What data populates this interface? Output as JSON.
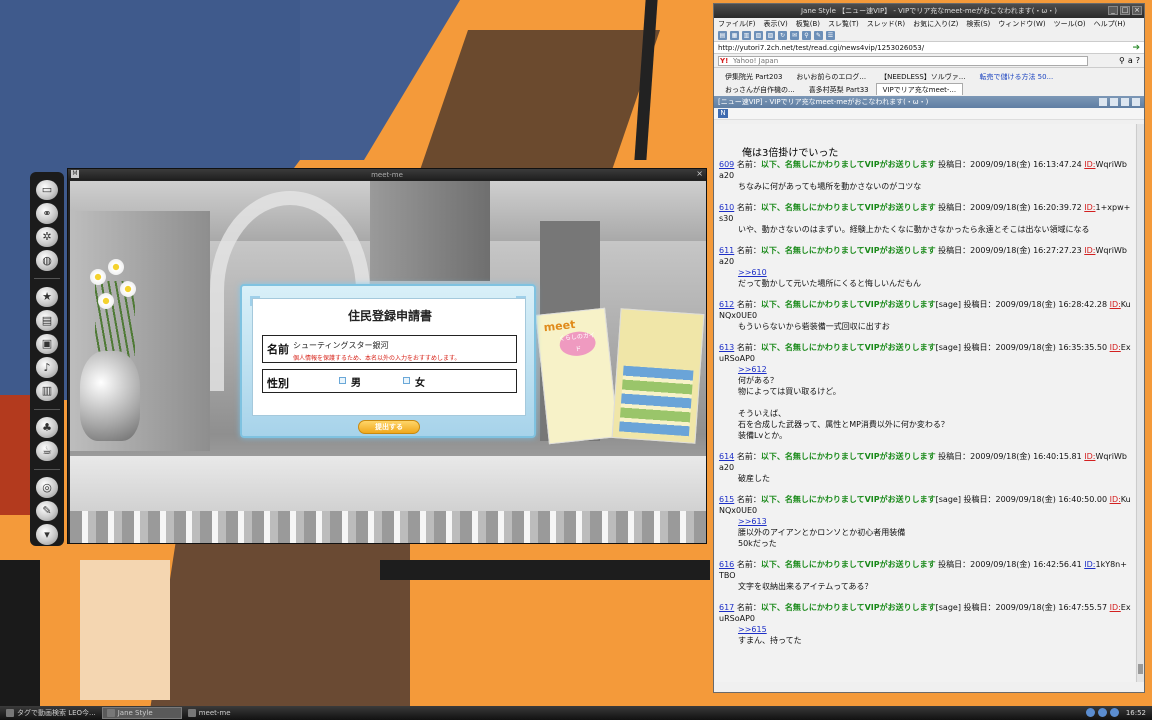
{
  "meetme": {
    "title": "meet-me",
    "brochure_logo": "meet",
    "brochure_guide": "くらしのガイド",
    "dialog": {
      "title": "住民登録申請書",
      "name_label": "名前",
      "name_value": "シューティングスター銀河",
      "name_note": "個人情報を保護するため、本名以外の入力をおすすめします。",
      "gender_label": "性別",
      "male": "男",
      "female": "女",
      "submit": "提出する"
    }
  },
  "jane": {
    "title": "Jane Style 【ニュー速VIP】 - VIPでリア充なmeet-meがおこなわれます(・ω・)",
    "menu": [
      "ファイル(F)",
      "表示(V)",
      "板覧(B)",
      "スレ覧(T)",
      "スレッド(R)",
      "お気に入り(Z)",
      "検索(S)",
      "ウィンドウ(W)",
      "ツール(O)",
      "ヘルプ(H)"
    ],
    "url": "http://yutori7.2ch.net/test/read.cgi/news4vip/1253026053/",
    "search_placeholder": "Yahoo! Japan",
    "tabs": [
      {
        "label": "伊集院光 Part203",
        "blue": false,
        "active": false
      },
      {
        "label": "おいお前らのエログ...",
        "blue": false,
        "active": false
      },
      {
        "label": "【NEEDLESS】ソルヴァ...",
        "blue": false,
        "active": false
      },
      {
        "label": "転売で儲ける方法 50...",
        "blue": true,
        "active": false
      },
      {
        "label": "おっさんが自作機の...",
        "blue": false,
        "active": false
      },
      {
        "label": "喜多村英梨 Part33",
        "blue": false,
        "active": false
      },
      {
        "label": "VIPでリア充なmeet-...",
        "blue": false,
        "active": true
      }
    ],
    "thread_title": "[ニュー速VIP] - VIPでリア充なmeet-meがおこなわれます(・ω・)",
    "first_line": "俺は3倍掛けでいった",
    "posts": [
      {
        "num": "609",
        "name_prefix": "名前：",
        "name": "以下、名無しにかわりましてVIPがお送りします",
        "mail": "",
        "date": "投稿日：2009/09/18(金) 16:13:47.24",
        "id_label": "ID:",
        "id": "WqriWba20",
        "id_red": true,
        "anchor": "",
        "lines": [
          "ちなみに何があっても場所を動かさないのがコツな"
        ]
      },
      {
        "num": "610",
        "name_prefix": "名前：",
        "name": "以下、名無しにかわりましてVIPがお送りします",
        "mail": "",
        "date": "投稿日：2009/09/18(金) 16:20:39.72",
        "id_label": "ID:",
        "id": "1+xpw+s30",
        "id_red": true,
        "anchor": "",
        "lines": [
          "いや、動かさないのはまずい。経験上かたくなに動かさなかったら永遠とそこは出ない領域になる"
        ]
      },
      {
        "num": "611",
        "name_prefix": "名前：",
        "name": "以下、名無しにかわりましてVIPがお送りします",
        "mail": "",
        "date": "投稿日：2009/09/18(金) 16:27:27.23",
        "id_label": "ID:",
        "id": "WqriWba20",
        "id_red": true,
        "anchor": ">>610",
        "lines": [
          "だって動かして元いた場所にくると悔しいんだもん"
        ]
      },
      {
        "num": "612",
        "name_prefix": "名前：",
        "name": "以下、名無しにかわりましてVIPがお送りします",
        "mail": "[sage]",
        "date": "投稿日：2009/09/18(金) 16:28:42.28",
        "id_label": "ID:",
        "id": "KuNQx0UE0",
        "id_red": true,
        "anchor": "",
        "lines": [
          "もういらないから砦装備一式回収に出すお"
        ]
      },
      {
        "num": "613",
        "name_prefix": "名前：",
        "name": "以下、名無しにかわりましてVIPがお送りします",
        "mail": "[sage]",
        "date": "投稿日：2009/09/18(金) 16:35:35.50",
        "id_label": "ID:",
        "id": "ExuRSoAP0",
        "id_red": true,
        "anchor": ">>612",
        "lines": [
          "何がある？",
          "物によっては買い取るけど。",
          "",
          "そういえば、",
          "石を合成した武器って、属性とMP消費以外に何か変わる？",
          "装備Lvとか。"
        ]
      },
      {
        "num": "614",
        "name_prefix": "名前：",
        "name": "以下、名無しにかわりましてVIPがお送りします",
        "mail": "",
        "date": "投稿日：2009/09/18(金) 16:40:15.81",
        "id_label": "ID:",
        "id": "WqriWba20",
        "id_red": true,
        "anchor": "",
        "lines": [
          "破産した"
        ]
      },
      {
        "num": "615",
        "name_prefix": "名前：",
        "name": "以下、名無しにかわりましてVIPがお送りします",
        "mail": "[sage]",
        "date": "投稿日：2009/09/18(金) 16:40:50.00",
        "id_label": "ID:",
        "id": "KuNQx0UE0",
        "id_red": true,
        "anchor": ">>613",
        "lines": [
          "腰以外のアイアンとかロンソとか初心者用装備",
          "50kだった"
        ]
      },
      {
        "num": "616",
        "name_prefix": "名前：",
        "name": "以下、名無しにかわりましてVIPがお送りします",
        "mail": "",
        "date": "投稿日：2009/09/18(金) 16:42:56.41",
        "id_label": "ID:",
        "id": "1kY8n+TBO",
        "id_red": false,
        "anchor": "",
        "lines": [
          "文字を収納出来るアイテムってある？"
        ]
      },
      {
        "num": "617",
        "name_prefix": "名前：",
        "name": "以下、名無しにかわりましてVIPがお送りします",
        "mail": "[sage]",
        "date": "投稿日：2009/09/18(金) 16:47:55.57",
        "id_label": "ID:",
        "id": "ExuRSoAP0",
        "id_red": true,
        "anchor": ">>615",
        "lines": [
          "すまん、持ってた"
        ]
      }
    ]
  },
  "taskbar": {
    "items": [
      {
        "label": "タグで動画検索 LEO今..."
      },
      {
        "label": "Jane Style"
      },
      {
        "label": "meet-me"
      }
    ],
    "clock": "16:52"
  }
}
